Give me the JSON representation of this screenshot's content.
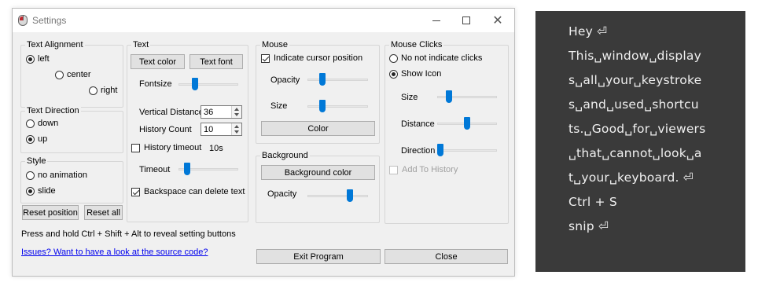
{
  "window": {
    "title": "Settings"
  },
  "text_alignment": {
    "title": "Text Alignment",
    "options": [
      {
        "label": "left",
        "selected": true
      },
      {
        "label": "center",
        "selected": false
      },
      {
        "label": "right",
        "selected": false
      }
    ]
  },
  "text_direction": {
    "title": "Text Direction",
    "options": [
      {
        "label": "down",
        "selected": false
      },
      {
        "label": "up",
        "selected": true
      }
    ]
  },
  "style": {
    "title": "Style",
    "options": [
      {
        "label": "no animation",
        "selected": false
      },
      {
        "label": "slide",
        "selected": true
      }
    ]
  },
  "reset_position_label": "Reset position",
  "reset_all_label": "Reset all",
  "text": {
    "title": "Text",
    "text_color_label": "Text color",
    "text_font_label": "Text font",
    "fontsize_label": "Fontsize",
    "fontsize_level": 0.28,
    "vertical_distance_label": "Vertical Distance",
    "vertical_distance_value": "36",
    "history_count_label": "History Count",
    "history_count_value": "10",
    "history_timeout_label": "History timeout",
    "history_timeout_checked": false,
    "history_timeout_value": "10s",
    "timeout_label": "Timeout",
    "timeout_level": 0.14,
    "backspace_label": "Backspace can delete text",
    "backspace_checked": true
  },
  "mouse": {
    "title": "Mouse",
    "indicate_label": "Indicate cursor position",
    "indicate_checked": true,
    "opacity_label": "Opacity",
    "opacity_level": 0.25,
    "size_label": "Size",
    "size_level": 0.25,
    "color_label": "Color"
  },
  "background": {
    "title": "Background",
    "color_label": "Background color",
    "opacity_label": "Opacity",
    "opacity_level": 0.7
  },
  "mouse_clicks": {
    "title": "Mouse Clicks",
    "options": [
      {
        "label": "No not indicate clicks",
        "selected": false
      },
      {
        "label": "Show Icon",
        "selected": true
      }
    ],
    "size_label": "Size",
    "size_level": 0.2,
    "distance_label": "Distance",
    "distance_level": 0.5,
    "direction_label": "Direction",
    "direction_level": 0.05,
    "add_history_label": "Add To History",
    "add_history_checked": false
  },
  "hint": "Press and hold Ctrl + Shift + Alt to reveal setting buttons",
  "source_link": "Issues? Want to have a look at the source code?",
  "exit_label": "Exit Program",
  "close_label": "Close",
  "keystroke_display": {
    "background": "#3a3a3a",
    "lines": [
      "Hey ⏎",
      "This␣window␣display",
      "s␣all␣your␣keystroke",
      "s␣and␣used␣shortcu",
      "ts.␣Good␣for␣viewers",
      "␣that␣cannot␣look␣a",
      "t␣your␣keyboard. ⏎",
      "Ctrl + S",
      "snip ⏎"
    ]
  },
  "accent_color": "#0078d7"
}
